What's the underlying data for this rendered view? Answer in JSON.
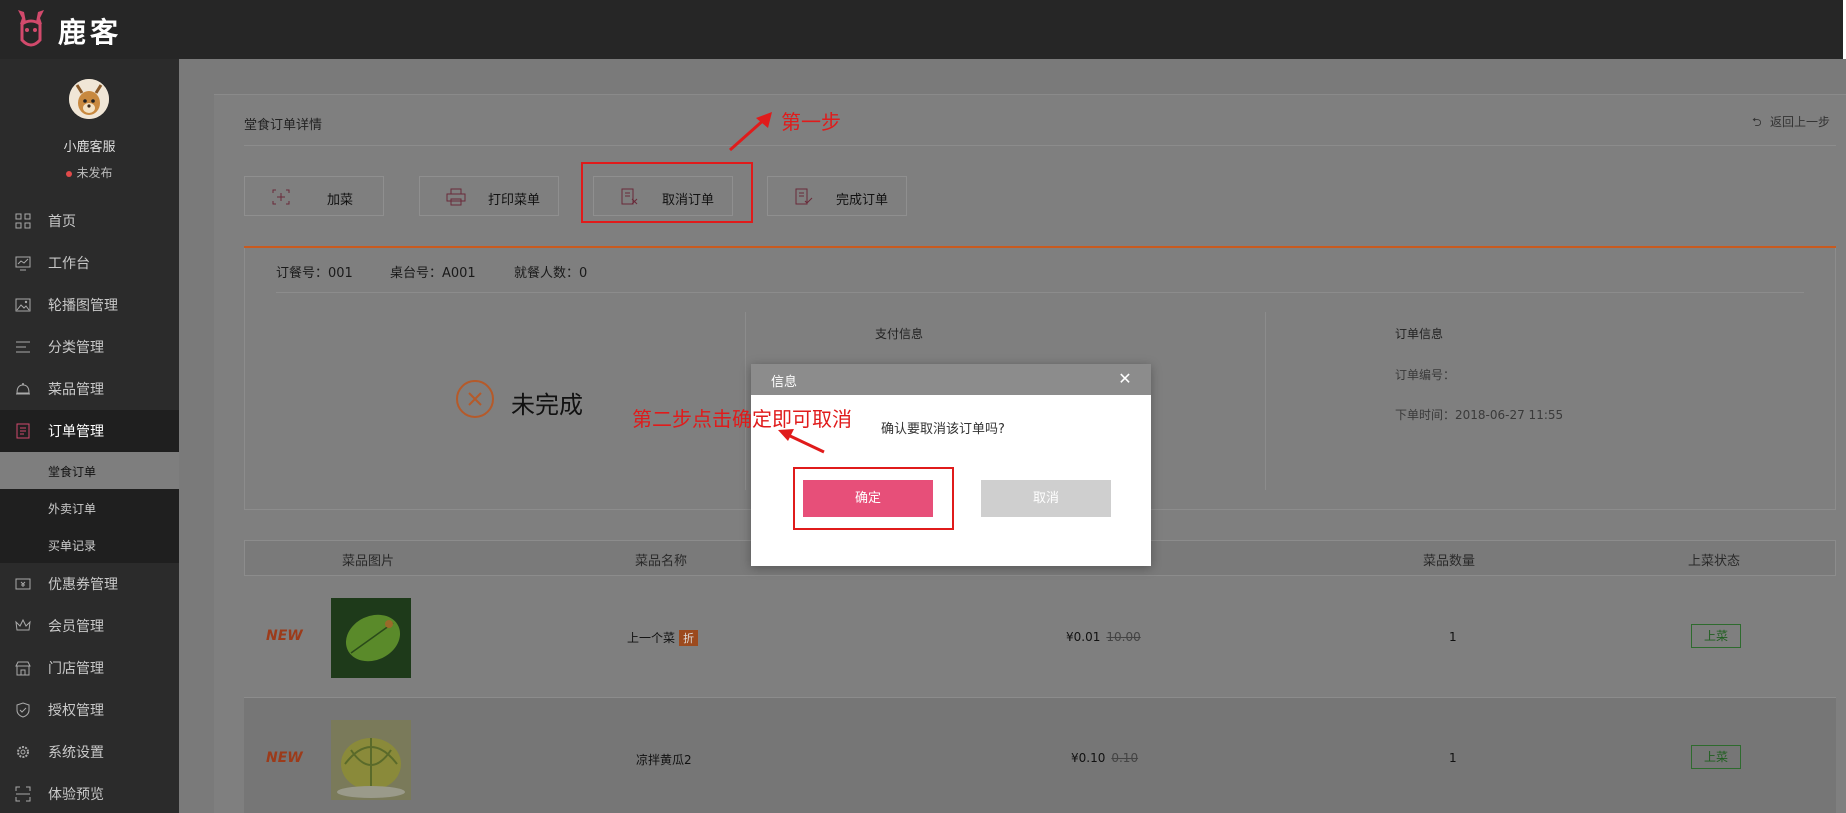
{
  "app": {
    "logo_text": "鹿客"
  },
  "profile": {
    "name": "小鹿客服",
    "status": "未发布"
  },
  "sidebar": {
    "items": [
      {
        "label": "首页",
        "icon": "grid-icon"
      },
      {
        "label": "工作台",
        "icon": "chart-icon"
      },
      {
        "label": "轮播图管理",
        "icon": "image-icon"
      },
      {
        "label": "分类管理",
        "icon": "list-icon"
      },
      {
        "label": "菜品管理",
        "icon": "cloche-icon"
      },
      {
        "label": "订单管理",
        "icon": "order-icon",
        "active": true
      },
      {
        "label": "优惠券管理",
        "icon": "coupon-icon"
      },
      {
        "label": "会员管理",
        "icon": "crown-icon"
      },
      {
        "label": "门店管理",
        "icon": "store-icon"
      },
      {
        "label": "授权管理",
        "icon": "shield-icon"
      },
      {
        "label": "系统设置",
        "icon": "gear-icon"
      },
      {
        "label": "体验预览",
        "icon": "scan-icon"
      }
    ],
    "sub_items": [
      {
        "label": "堂食订单",
        "active": true
      },
      {
        "label": "外卖订单"
      },
      {
        "label": "买单记录"
      }
    ]
  },
  "page": {
    "title": "堂食订单详情",
    "back": "返回上一步"
  },
  "toolbar": {
    "add_dish": "加菜",
    "print_menu": "打印菜单",
    "cancel_order": "取消订单",
    "complete_order": "完成订单"
  },
  "order": {
    "order_no": "订餐号：001",
    "table_no": "桌台号：A001",
    "diners": "就餐人数：0",
    "status": "未完成",
    "payment_title": "支付信息",
    "order_info_title": "订单信息",
    "order_number_label": "订单编号：",
    "order_time": "下单时间：2018-06-27 11:55"
  },
  "table": {
    "headers": [
      "菜品图片",
      "菜品名称",
      "菜品数量",
      "上菜状态"
    ],
    "rows": [
      {
        "tag": "NEW",
        "name": "上一个菜",
        "badge": "折",
        "price": "¥0.01",
        "old_price": "10.00",
        "qty": "1",
        "status": "上菜"
      },
      {
        "tag": "NEW",
        "name": "凉拌黄瓜2",
        "badge": "",
        "price": "¥0.10",
        "old_price": "0.10",
        "qty": "1",
        "status": "上菜"
      }
    ]
  },
  "modal": {
    "title": "信息",
    "message": "确认要取消该订单吗?",
    "confirm": "确定",
    "cancel": "取消"
  },
  "annotations": {
    "step1": "第一步",
    "step2": "第二步点击确定即可取消"
  },
  "colors": {
    "accent": "#e74f79",
    "annotation": "#e01b1b",
    "topbar": "#262626",
    "sidebar": "#2b2b2b"
  }
}
